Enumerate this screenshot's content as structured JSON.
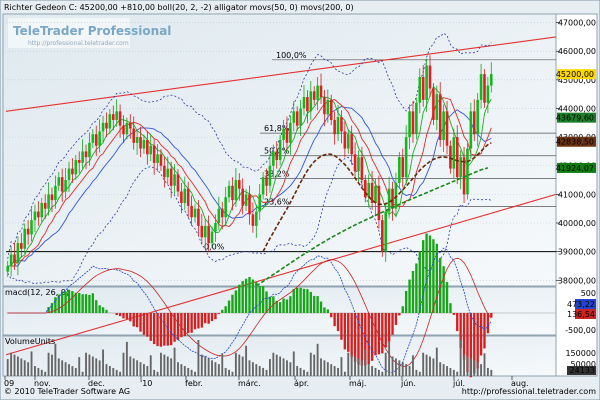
{
  "header": {
    "title": "Richter Gedeon C: 45200,00 +810,00 boll(20, 2, -2) alligator movs(50, 0) movs(200, 0)",
    "watermark_brand": "TeleTrader Professional",
    "watermark_url": "http://professional.teletrader.com"
  },
  "footer": {
    "copyright": "© 2010 TeleTrader Software AG",
    "url": "http://professional.teletrader.com"
  },
  "panels": {
    "price_ticks": [
      "47000,00",
      "46000,00",
      "45000,00",
      "44000,00",
      "43000,00",
      "42000,00",
      "41000,00",
      "40000,00",
      "39000,00",
      "38000,00"
    ],
    "price_badges": [
      {
        "text": "45200,00",
        "color": "#ffd800",
        "text_color": "#000000"
      },
      {
        "text": "43679,60",
        "color": "#1c7e28",
        "text_color": "#ffffff"
      },
      {
        "text": "42838,50",
        "color": "#6b3410",
        "text_color": "#ffffff"
      },
      {
        "text": "41924,07",
        "color": "#0d7f10",
        "text_color": "#ffffff"
      }
    ],
    "fib_labels": [
      "100,0%",
      "61,8%",
      "50,0%",
      "38,2%",
      "23,6%",
      "0,0%"
    ],
    "macd_label": "macd(12, 26, 9)",
    "macd_ticks": [
      "500",
      "0,00",
      "-500,00"
    ],
    "macd_badges": [
      {
        "text": "473,22",
        "color": "#2244cc",
        "text_color": "#ffffff"
      },
      {
        "text": "136,54",
        "color": "#cc2222",
        "text_color": "#ffffff"
      }
    ],
    "volume_label": "VolumeUnits",
    "volume_ticks": [
      "150000",
      "50000"
    ],
    "volume_badge": {
      "text": "24133",
      "color": "#333333",
      "text_color": "#ffffff"
    },
    "x_labels": [
      "09",
      "nov.",
      "dec.",
      "'10",
      "febr.",
      "márc.",
      "ápr.",
      "máj.",
      "jún.",
      "júl.",
      "aug."
    ]
  },
  "chart_data": {
    "type": "candlestick",
    "title": "Richter Gedeon C: 45200,00 +810,00 boll(20, 2, -2) alligator movs(50, 0) movs(200, 0)",
    "x_labels": [
      "09",
      "nov.",
      "dec.",
      "'10",
      "febr.",
      "márc.",
      "ápr.",
      "máj.",
      "jún.",
      "júl.",
      "aug."
    ],
    "ylim": [
      37800,
      47300
    ],
    "last_price": 45200,
    "change": 810,
    "closes": [
      38500,
      38900,
      38600,
      39300,
      39100,
      39800,
      39600,
      40100,
      40400,
      40200,
      40700,
      40500,
      41000,
      40800,
      41300,
      41600,
      41100,
      41500,
      41900,
      41700,
      42200,
      42100,
      42500,
      42300,
      42800,
      43100,
      42700,
      43200,
      43500,
      43300,
      43800,
      43600,
      43900,
      43400,
      43100,
      43500,
      43300,
      42800,
      43000,
      42600,
      42900,
      42400,
      42700,
      42100,
      42400,
      42000,
      41600,
      41900,
      41300,
      41700,
      41100,
      40700,
      41200,
      40600,
      40200,
      40500,
      39900,
      39500,
      39900,
      39300,
      39700,
      40000,
      40500,
      40200,
      40900,
      41300,
      40800,
      41500,
      41200,
      40600,
      41000,
      40300,
      39900,
      40400,
      41000,
      41600,
      41300,
      42000,
      42500,
      42200,
      42900,
      43300,
      42800,
      43500,
      43900,
      43400,
      44000,
      44400,
      43900,
      44600,
      44300,
      44800,
      44400,
      43800,
      44300,
      43600,
      43100,
      43700,
      43200,
      42600,
      43100,
      42400,
      41800,
      42300,
      41500,
      40900,
      41400,
      40700,
      41300,
      40100,
      39000,
      40400,
      41200,
      40500,
      41400,
      42300,
      41600,
      43000,
      43900,
      43100,
      44200,
      45100,
      44300,
      45500,
      44700,
      43600,
      44500,
      42900,
      43900,
      42700,
      41900,
      43000,
      41600,
      42300,
      41000,
      42600,
      43900,
      43100,
      44300,
      45200,
      44200,
      44800,
      45200
    ],
    "sma50": [
      39000,
      39240,
      39460,
      39660,
      39880,
      40090,
      40300,
      40500,
      40720,
      40950,
      41180,
      41420,
      41630,
      41830,
      42000,
      42140,
      42250,
      42330,
      42380,
      42410,
      42400,
      42350,
      42270,
      42160,
      42040,
      41900,
      41740,
      41570,
      41400,
      41230,
      41070,
      40920,
      40800,
      40710,
      40660,
      40650,
      40670,
      40720,
      40800,
      40910,
      41030,
      41160,
      41290,
      41420,
      41560,
      41700,
      41840,
      41960,
      42060,
      42150,
      42220,
      42270,
      42300,
      42310,
      42290,
      42260,
      42220,
      42180,
      42150,
      42140,
      42150,
      42200,
      42280,
      42390,
      42510,
      42630,
      42740,
      42800
    ],
    "sma200": [
      37800,
      37960,
      38120,
      38280,
      38440,
      38600,
      38760,
      38910,
      39060,
      39210,
      39350,
      39490,
      39620,
      39750,
      39870,
      39990,
      40100,
      40210,
      40320,
      40430,
      40540,
      40650,
      40760,
      40860,
      40960,
      41060,
      41160,
      41260,
      41360,
      41460,
      41560,
      41660,
      41760,
      41860,
      41924
    ],
    "fibonacci": {
      "levels": [
        "100,0%",
        "61,8%",
        "50,0%",
        "38,2%",
        "23,6%",
        "0,0%"
      ],
      "high": 45700,
      "low": 39000
    },
    "channel": {
      "upper": [
        [
          0,
          43900
        ],
        [
          1,
          46500
        ]
      ],
      "lower": [
        [
          0,
          35400
        ],
        [
          1,
          41000
        ]
      ]
    },
    "macd_panel": {
      "name": "macd(12, 26, 9)",
      "ylim": [
        -500,
        500
      ],
      "last_macd": 473.22,
      "last_signal": 136.54
    },
    "volume_panel": {
      "name": "VolumeUnits",
      "ylim": [
        0,
        170000
      ],
      "last": 24133
    }
  }
}
